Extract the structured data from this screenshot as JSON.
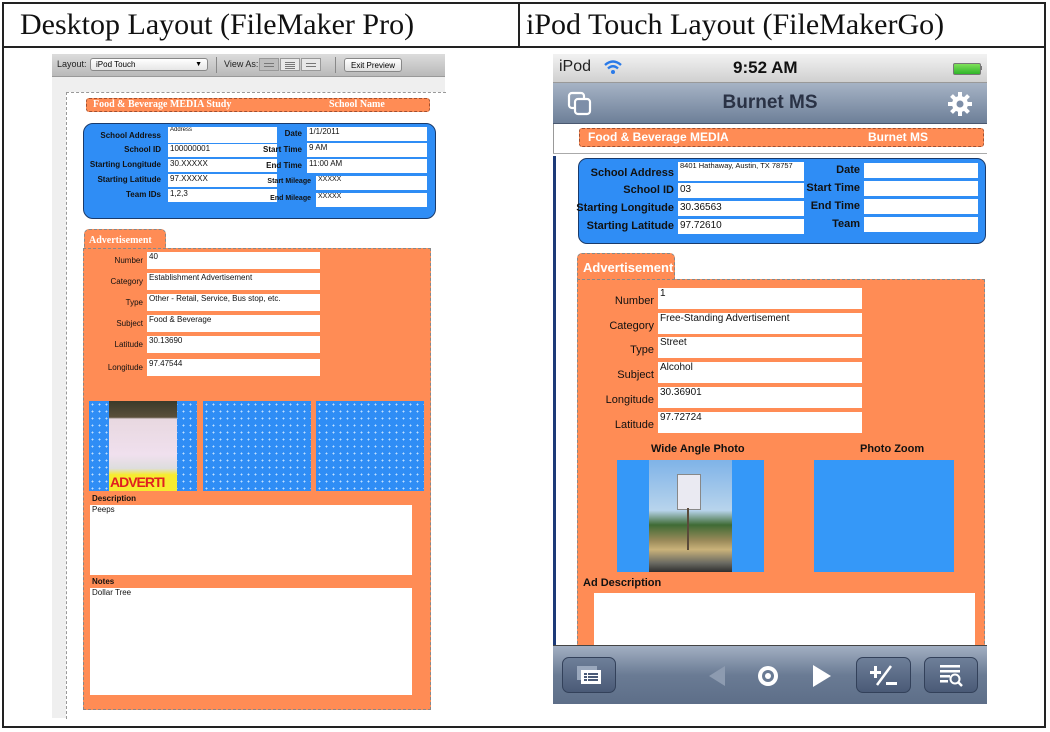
{
  "columns": {
    "desktop_title": "Desktop Layout (FileMaker Pro)",
    "ipod_title": "iPod Touch Layout (FileMakerGo)"
  },
  "desktop": {
    "toolbar": {
      "layout_label": "Layout:",
      "layout_value": "iPod Touch",
      "view_as_label": "View As:",
      "exit_preview": "Exit Preview"
    },
    "header": {
      "title": "Food & Beverage MEDIA Study",
      "school": "School Name"
    },
    "school_info": {
      "left": [
        {
          "label": "School Address",
          "value": "Address"
        },
        {
          "label": "School ID",
          "value": "100000001"
        },
        {
          "label": "Starting Longitude",
          "value": "30.XXXXX"
        },
        {
          "label": "Starting Latitude",
          "value": "97.XXXXX"
        },
        {
          "label": "Team IDs",
          "value": "1,2,3"
        }
      ],
      "right": [
        {
          "label": "Date",
          "value": "1/1/2011"
        },
        {
          "label": "Start Time",
          "value": "9 AM"
        },
        {
          "label": "End Time",
          "value": "11:00 AM"
        },
        {
          "label": "Start Mileage",
          "value": "XXXXX"
        },
        {
          "label": "End Mileage",
          "value": "XXXXX"
        }
      ]
    },
    "ad_tab": "Advertisement",
    "ad_fields": [
      {
        "label": "Number",
        "value": "40"
      },
      {
        "label": "Category",
        "value": "Establishment Advertisement"
      },
      {
        "label": "Type",
        "value": "Other - Retail, Service, Bus stop, etc."
      },
      {
        "label": "Subject",
        "value": "Food & Beverage"
      },
      {
        "label": "Latitude",
        "value": "30.13690"
      },
      {
        "label": "Longitude",
        "value": "97.47544"
      }
    ],
    "photo_caption": "ADVERTI",
    "description_label": "Description",
    "description_value": "Peeps",
    "notes_label": "Notes",
    "notes_value": "Dollar Tree"
  },
  "ipod": {
    "status": {
      "carrier": "iPod",
      "time": "9:52 AM",
      "battery_pct": 100
    },
    "nav_title": "Burnet MS",
    "header": {
      "title": "Food & Beverage MEDIA",
      "school": "Burnet MS"
    },
    "school_info": {
      "left": [
        {
          "label": "School Address",
          "value": "8401 Hathaway, Austin, TX 78757"
        },
        {
          "label": "School ID",
          "value": "03"
        },
        {
          "label": "Starting Longitude",
          "value": "30.36563"
        },
        {
          "label": "Starting Latitude",
          "value": "97.72610"
        }
      ],
      "right": [
        {
          "label": "Date",
          "value": ""
        },
        {
          "label": "Start Time",
          "value": ""
        },
        {
          "label": "End Time",
          "value": ""
        },
        {
          "label": "Team",
          "value": ""
        }
      ]
    },
    "ad_tab": "Advertisement",
    "ad_fields": [
      {
        "label": "Number",
        "value": "1"
      },
      {
        "label": "Category",
        "value": "Free-Standing Advertisement"
      },
      {
        "label": "Type",
        "value": "Street"
      },
      {
        "label": "Subject",
        "value": "Alcohol"
      },
      {
        "label": "Longitude",
        "value": "30.36901"
      },
      {
        "label": "Latitude",
        "value": "97.72724"
      }
    ],
    "photo_wide_label": "Wide Angle Photo",
    "photo_zoom_label": "Photo Zoom",
    "ad_description_label": "Ad Description",
    "ad_description_value": "",
    "toolbar": [
      "layouts-icon",
      "prev-record-icon",
      "record-indicator-icon",
      "next-record-icon",
      "add-delete-icon",
      "find-icon"
    ]
  }
}
